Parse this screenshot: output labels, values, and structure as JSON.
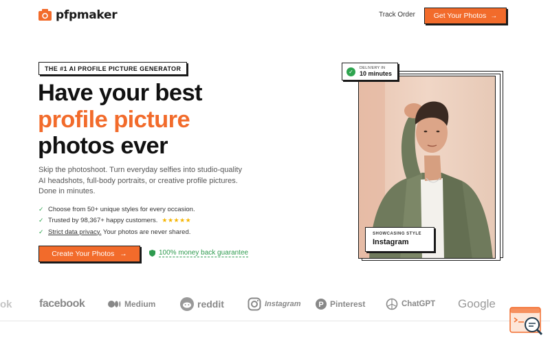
{
  "brand": {
    "name": "pfpmaker",
    "color": "#f26b2b"
  },
  "nav": {
    "track_order": "Track Order",
    "cta": "Get Your Photos",
    "cta_icon": "arrow-right-icon"
  },
  "hero": {
    "tag": "THE #1 AI PROFILE PICTURE GENERATOR",
    "headline_line1": "Have your best",
    "headline_line2": "profile picture",
    "headline_line3": "photos ever",
    "subtext": "Skip the photoshoot. Turn everyday selfies into studio-quality AI headshots, full-body portraits, or creative profile pictures. Done in minutes.",
    "checks": {
      "item1": "Choose from 50+ unique styles for every occasion.",
      "item2": "Trusted by 98,367+ happy customers.",
      "item2_stars": "★★★★★",
      "item3_link": "Strict data privacy.",
      "item3_rest": " Your photos are never shared."
    },
    "cta": "Create Your Photos",
    "guarantee": "100% money back guarantee"
  },
  "photo": {
    "delivery_small": "DELIVERY IN",
    "delivery_big": "10 minutes",
    "style_small": "SHOWCASING STYLE",
    "style_big": "Instagram"
  },
  "logos": {
    "partial": "ok",
    "facebook": "facebook",
    "medium": "Medium",
    "reddit": "reddit",
    "instagram": "Instagram",
    "pinterest": "Pinterest",
    "chatgpt": "ChatGPT",
    "google": "Google"
  }
}
